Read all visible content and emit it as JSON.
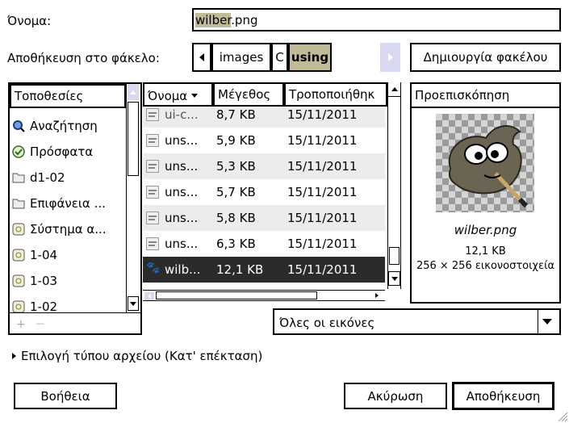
{
  "name_label": "Όνομα:",
  "filename": {
    "selected": "wilber",
    "rest": ".png"
  },
  "save_in_label": "Αποθήκευση στο φάκελο:",
  "path": [
    "images",
    "C",
    "using"
  ],
  "create_folder_label": "Δημιουργία φακέλου",
  "places": {
    "header": "Τοποθεσίες",
    "items": [
      {
        "label": "Αναζήτηση",
        "icon": "search-icon"
      },
      {
        "label": "Πρόσφατα",
        "icon": "recent-icon"
      },
      {
        "label": "d1-02",
        "icon": "folder-icon"
      },
      {
        "label": "Επιφάνεια ...",
        "icon": "folder-icon"
      },
      {
        "label": "Σύστημα α...",
        "icon": "drive-icon"
      },
      {
        "label": "1-04",
        "icon": "drive-icon"
      },
      {
        "label": "1-03",
        "icon": "drive-icon"
      },
      {
        "label": "1-02",
        "icon": "drive-icon"
      }
    ],
    "add_glyph": "+",
    "remove_glyph": "—"
  },
  "files": {
    "columns": [
      "Όνομα",
      "Μέγεθος",
      "Τροποποιήθηκ"
    ],
    "rows": [
      {
        "name": "ui-c...",
        "size": "8,7 KB",
        "modified": "15/11/2011"
      },
      {
        "name": "uns...",
        "size": "5,9 KB",
        "modified": "15/11/2011"
      },
      {
        "name": "uns...",
        "size": "5,3 KB",
        "modified": "15/11/2011"
      },
      {
        "name": "uns...",
        "size": "5,7 KB",
        "modified": "15/11/2011"
      },
      {
        "name": "uns...",
        "size": "5,8 KB",
        "modified": "15/11/2011"
      },
      {
        "name": "uns...",
        "size": "6,3 KB",
        "modified": "15/11/2011"
      },
      {
        "name": "wilb...",
        "size": "12,1 KB",
        "modified": "15/11/2011"
      }
    ]
  },
  "preview": {
    "header": "Προεπισκόπηση",
    "filename": "wilber.png",
    "size": "12,1 KB",
    "dimensions": "256 × 256 εικονοστοιχεία"
  },
  "filter": {
    "value": "Όλες οι εικόνες"
  },
  "file_type_label": "Επιλογή τύπου αρχείου (Κατ' επέκταση)",
  "buttons": {
    "help": "Βοήθεια",
    "cancel": "Ακύρωση",
    "save": "Αποθήκευση"
  },
  "colors": {
    "selection": "#c0bb97",
    "current_row": "#2b2b2b",
    "accent_arrow": "#d8d8f0"
  }
}
